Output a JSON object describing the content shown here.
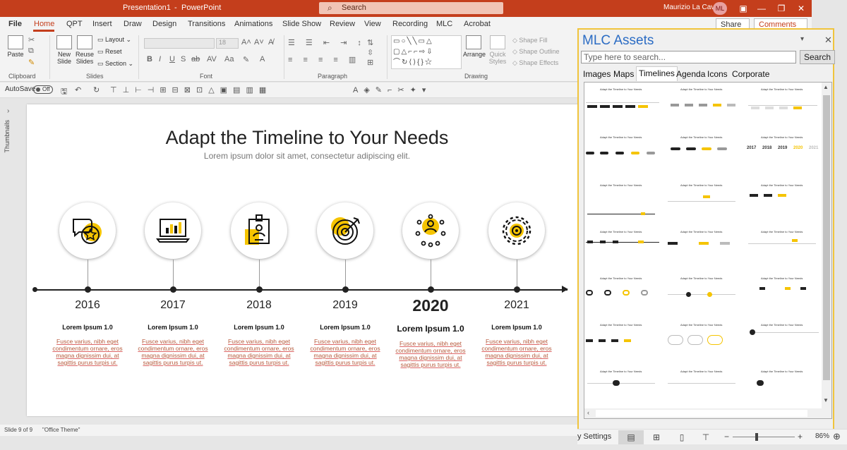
{
  "titlebar": {
    "doc": "Presentation1",
    "sep": "-",
    "app": "PowerPoint",
    "search_placeholder": "Search",
    "user": "Maurizio La Cava",
    "initials": "ML"
  },
  "tabs": [
    "File",
    "Home",
    "QPT",
    "Insert",
    "Draw",
    "Design",
    "Transitions",
    "Animations",
    "Slide Show",
    "Review",
    "View",
    "Recording",
    "MLC",
    "Acrobat"
  ],
  "share": "Share",
  "comments": "Comments",
  "ribbon": {
    "paste": "Paste",
    "clipboard": "Clipboard",
    "new_slide_1": "New",
    "new_slide_2": "Slide",
    "reuse_1": "Reuse",
    "reuse_2": "Slides",
    "layout": "Layout",
    "reset": "Reset",
    "section": "Section",
    "slides": "Slides",
    "font_size": "18",
    "font": "Font",
    "paragraph": "Paragraph",
    "arrange": "Arrange",
    "quick_1": "Quick",
    "quick_2": "Styles",
    "shape_fill": "Shape Fill",
    "shape_outline": "Shape Outline",
    "shape_effects": "Shape Effects",
    "drawing": "Drawing"
  },
  "qat": {
    "autosave": "AutoSave",
    "toggle": "Off"
  },
  "thumbnails_label": "Thumbnails",
  "slide": {
    "title": "Adapt the Timeline to Your Needs",
    "subtitle": "Lorem ipsum dolor sit amet, consectetur adipiscing elit.",
    "items": [
      {
        "year": "2016",
        "title": "Lorem Ipsum 1.0",
        "desc1": "Fusce varius, nibh eget",
        "desc2": "condimentum ornare, eros",
        "desc3": "magna dignissim dui, at",
        "desc4": "sagittis purus turpis ut.",
        "icon": "chat-star-icon"
      },
      {
        "year": "2017",
        "title": "Lorem Ipsum 1.0",
        "desc1": "Fusce varius, nibh eget",
        "desc2": "condimentum ornare, eros",
        "desc3": "magna dignissim dui, at",
        "desc4": "sagittis purus turpis ut.",
        "icon": "laptop-chart-icon"
      },
      {
        "year": "2018",
        "title": "Lorem Ipsum 1.0",
        "desc1": "Fusce varius, nibh eget",
        "desc2": "condimentum ornare, eros",
        "desc3": "magna dignissim dui, at",
        "desc4": "sagittis purus turpis ut.",
        "icon": "id-badge-icon"
      },
      {
        "year": "2019",
        "title": "Lorem Ipsum 1.0",
        "desc1": "Fusce varius, nibh eget",
        "desc2": "condimentum ornare, eros",
        "desc3": "magna dignissim dui, at",
        "desc4": "sagittis purus turpis ut.",
        "icon": "target-icon"
      },
      {
        "year": "2020",
        "title": "Lorem Ipsum 1.0",
        "desc1": "Fusce varius, nibh eget",
        "desc2": "condimentum ornare, eros",
        "desc3": "magna dignissim dui, at",
        "desc4": "sagittis purus turpis ut.",
        "icon": "team-icon"
      },
      {
        "year": "2021",
        "title": "Lorem Ipsum 1.0",
        "desc1": "Fusce varius, nibh eget",
        "desc2": "condimentum ornare, eros",
        "desc3": "magna dignissim dui, at",
        "desc4": "sagittis purus turpis ut.",
        "icon": "gear-icon"
      }
    ]
  },
  "status": {
    "slide": "Slide 9 of 9",
    "theme": "\"Office Theme\""
  },
  "pane": {
    "title": "MLC Assets",
    "search_placeholder": "Type here to search...",
    "search_button": "Search",
    "tabs": [
      "Images",
      "Maps",
      "Timelines",
      "Agenda",
      "Icons",
      "Corporate"
    ],
    "thumb_title": "Adapt the Timeline to Your Needs",
    "years": [
      "2017",
      "2018",
      "2019",
      "2020",
      "2021"
    ]
  },
  "bottom": {
    "settings": "y Settings",
    "zoom": "86%"
  },
  "colors": {
    "accent": "#c43e1c",
    "yellow": "#f5c400",
    "pane_border": "#f0c43c",
    "link": "#2b6cc4"
  }
}
